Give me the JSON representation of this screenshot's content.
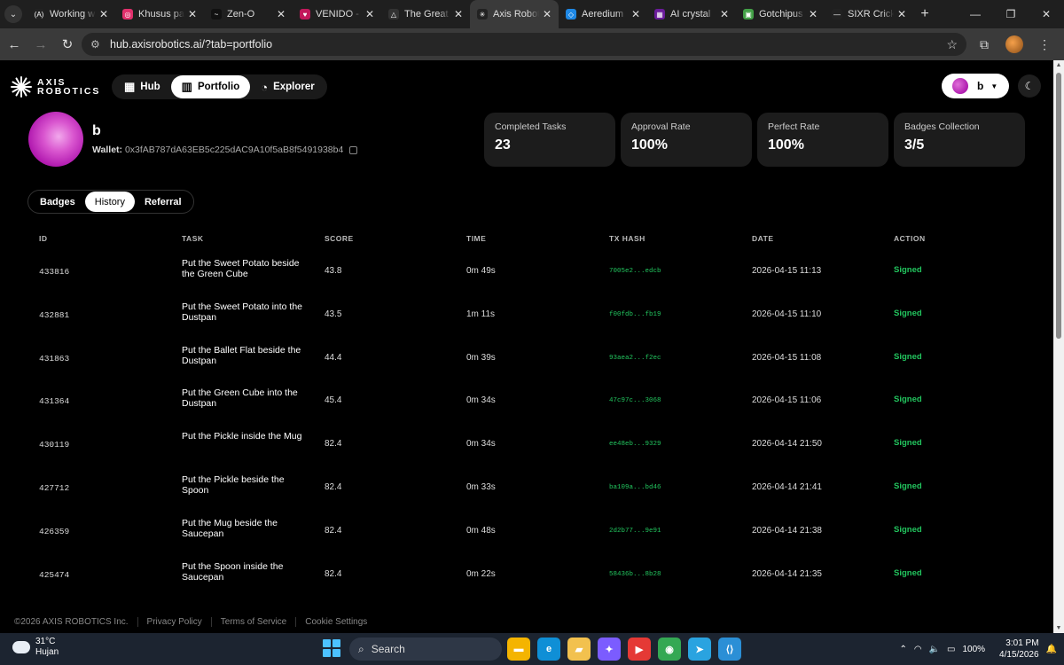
{
  "browser": {
    "tabs": [
      {
        "title": "Working w",
        "icon": "a-logo-icon",
        "color": "#222222",
        "glyph": "(A)",
        "active": false
      },
      {
        "title": "Khusus pa",
        "icon": "instagram-icon",
        "color": "#e1306c",
        "glyph": "◎",
        "active": false
      },
      {
        "title": "Zen-O",
        "icon": "zen-icon",
        "color": "#111111",
        "glyph": "~",
        "active": false
      },
      {
        "title": "VENIDO -",
        "icon": "venido-icon",
        "color": "#c2185b",
        "glyph": "♥",
        "active": false
      },
      {
        "title": "The Great",
        "icon": "triangle-icon",
        "color": "#333333",
        "glyph": "△",
        "active": false
      },
      {
        "title": "Axis Robot",
        "icon": "axis-star-icon",
        "color": "#222222",
        "glyph": "✳",
        "active": true
      },
      {
        "title": "Aeredium",
        "icon": "aeredium-icon",
        "color": "#1e88e5",
        "glyph": "◇",
        "active": false
      },
      {
        "title": "AI crystal",
        "icon": "crystal-icon",
        "color": "#6a1b9a",
        "glyph": "▦",
        "active": false
      },
      {
        "title": "Gotchipus",
        "icon": "gotchipus-icon",
        "color": "#43a047",
        "glyph": "▣",
        "active": false
      },
      {
        "title": "SIXR Crick",
        "icon": "sixr-icon",
        "color": "#222222",
        "glyph": "—",
        "active": false
      }
    ],
    "url": "hub.axisrobotics.ai/?tab=portfolio"
  },
  "header": {
    "logo_line1": "AXIS",
    "logo_line2": "ROBOTICS",
    "nav": [
      {
        "label": "Hub",
        "icon": "grid-icon",
        "glyph": "▦",
        "active": false
      },
      {
        "label": "Portfolio",
        "icon": "chart-icon",
        "glyph": "▥",
        "active": true
      },
      {
        "label": "Explorer",
        "icon": "compass-icon",
        "glyph": "◔",
        "active": false
      }
    ],
    "user_label": "b"
  },
  "profile": {
    "name": "b",
    "wallet_label": "Wallet:",
    "wallet_address": "0x3fAB787dA63EB5c225dAC9A10f5aB8f5491938b4"
  },
  "stats": [
    {
      "label": "Completed Tasks",
      "value": "23"
    },
    {
      "label": "Approval Rate",
      "value": "100%"
    },
    {
      "label": "Perfect Rate",
      "value": "100%"
    },
    {
      "label": "Badges Collection",
      "value": "3/5"
    }
  ],
  "subtabs": [
    {
      "label": "Badges",
      "active": false
    },
    {
      "label": "History",
      "active": true
    },
    {
      "label": "Referral",
      "active": false
    }
  ],
  "table": {
    "columns": [
      "ID",
      "TASK",
      "SCORE",
      "TIME",
      "TX HASH",
      "DATE",
      "ACTION"
    ],
    "rows": [
      {
        "id": "433816",
        "task": "Put the Sweet Potato beside the Green Cube",
        "score": "43.8",
        "time": "0m 49s",
        "tx": "7005e2...edcb",
        "date": "2026-04-15 11:13",
        "action": "Signed"
      },
      {
        "id": "432881",
        "task": "Put the Sweet Potato into the Dustpan",
        "score": "43.5",
        "time": "1m 11s",
        "tx": "f00fdb...fb19",
        "date": "2026-04-15 11:10",
        "action": "Signed"
      },
      {
        "id": "431863",
        "task": "Put the Ballet Flat beside the Dustpan",
        "score": "44.4",
        "time": "0m 39s",
        "tx": "93aea2...f2ec",
        "date": "2026-04-15 11:08",
        "action": "Signed"
      },
      {
        "id": "431364",
        "task": "Put the Green Cube into the Dustpan",
        "score": "45.4",
        "time": "0m 34s",
        "tx": "47c97c...3068",
        "date": "2026-04-15 11:06",
        "action": "Signed"
      },
      {
        "id": "430119",
        "task": "Put the Pickle inside the Mug",
        "score": "82.4",
        "time": "0m 34s",
        "tx": "ee48eb...9329",
        "date": "2026-04-14 21:50",
        "action": "Signed"
      },
      {
        "id": "427712",
        "task": "Put the Pickle beside the Spoon",
        "score": "82.4",
        "time": "0m 33s",
        "tx": "ba109a...bd46",
        "date": "2026-04-14 21:41",
        "action": "Signed"
      },
      {
        "id": "426359",
        "task": "Put the Mug beside the Saucepan",
        "score": "82.4",
        "time": "0m 48s",
        "tx": "2d2b77...9e91",
        "date": "2026-04-14 21:38",
        "action": "Signed"
      },
      {
        "id": "425474",
        "task": "Put the Spoon inside the Saucepan",
        "score": "82.4",
        "time": "0m 22s",
        "tx": "58436b...8b28",
        "date": "2026-04-14 21:35",
        "action": "Signed"
      }
    ]
  },
  "footer": {
    "copyright": "©2026 AXIS ROBOTICS Inc.",
    "links": [
      "Privacy Policy",
      "Terms of Service",
      "Cookie Settings"
    ]
  },
  "taskbar": {
    "temperature": "31°C",
    "weather": "Hujan",
    "search_label": "Search",
    "battery": "100%",
    "time": "3:01 PM",
    "date": "4/15/2026",
    "apps": [
      {
        "name": "file-explorer-icon",
        "color": "#f4b400",
        "glyph": "▬"
      },
      {
        "name": "edge-icon",
        "color": "#0f8fd6",
        "glyph": "e"
      },
      {
        "name": "folder-icon",
        "color": "#f2c14e",
        "glyph": "▰"
      },
      {
        "name": "copilot-icon",
        "color": "#7b5cff",
        "glyph": "✦"
      },
      {
        "name": "youtube-icon",
        "color": "#e53935",
        "glyph": "▶"
      },
      {
        "name": "chrome-icon",
        "color": "#34a853",
        "glyph": "◉"
      },
      {
        "name": "telegram-icon",
        "color": "#2aa3e0",
        "glyph": "➤"
      },
      {
        "name": "vscode-icon",
        "color": "#2b8fd6",
        "glyph": "⟨⟩"
      }
    ]
  }
}
